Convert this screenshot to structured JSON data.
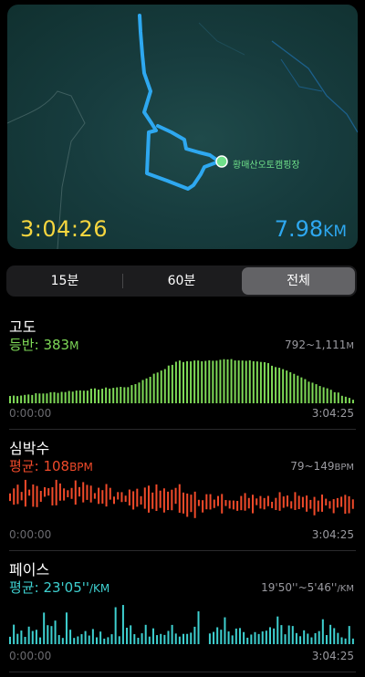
{
  "map": {
    "elapsed": "3:04:26",
    "distance_value": "7.98",
    "distance_unit": "KM",
    "place_label": "황매산오토캠핑장",
    "route_color": "#2ea8f0"
  },
  "segments": [
    {
      "label": "15분",
      "selected": false
    },
    {
      "label": "60분",
      "selected": false
    },
    {
      "label": "전체",
      "selected": true
    }
  ],
  "altitude": {
    "title": "고도",
    "sub_label": "등반:",
    "sub_value": "383",
    "sub_unit": "M",
    "range_value": "792~1,111",
    "range_unit": "M",
    "time_start": "0:00:00",
    "time_end": "3:04:25",
    "color": "#7ed957"
  },
  "heart": {
    "title": "심박수",
    "sub_label": "평균:",
    "sub_value": "108",
    "sub_unit": "BPM",
    "range_value": "79~149",
    "range_unit": "BPM",
    "time_start": "0:00:00",
    "time_end": "3:04:25",
    "color": "#f04a2a"
  },
  "pace": {
    "title": "페이스",
    "sub_label": "평균:",
    "sub_value": "23'05''",
    "sub_unit": "/KM",
    "range_value": "19'50''~5'46''",
    "range_unit": "/KM",
    "time_start": "0:00:00",
    "time_end": "3:04:25",
    "color": "#3ed0d0"
  }
}
